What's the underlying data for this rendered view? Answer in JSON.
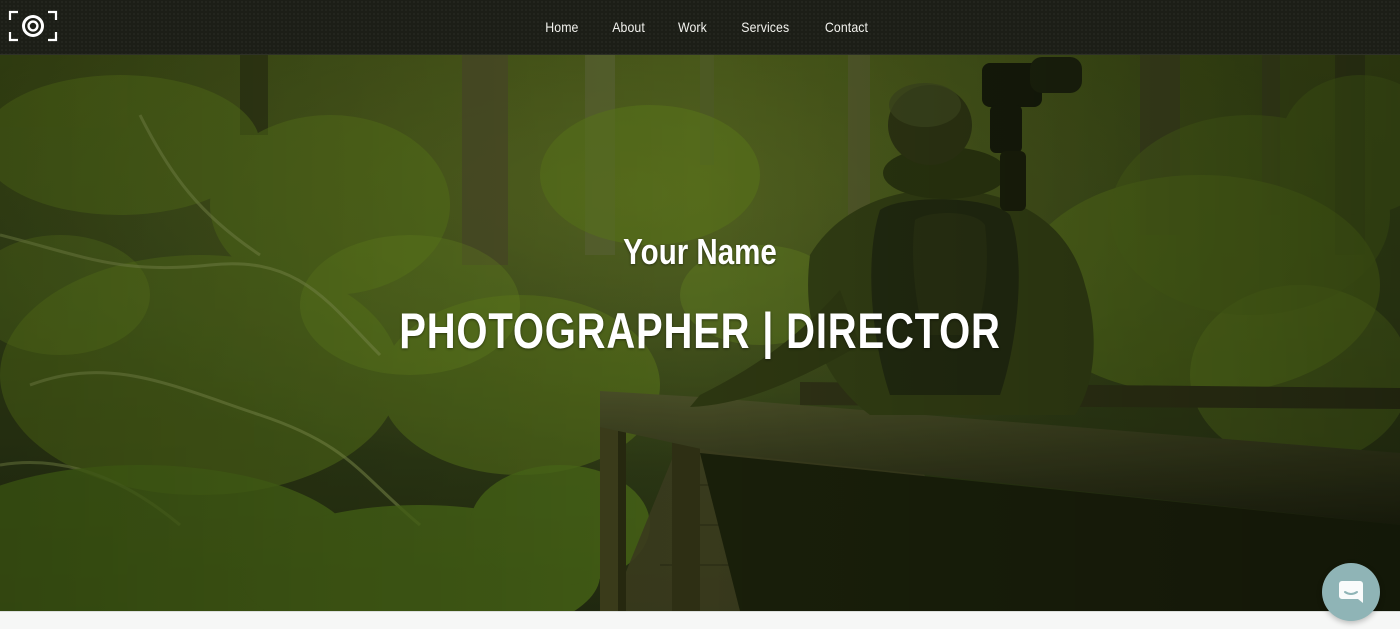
{
  "nav": {
    "logo_icon": "camera-lens-viewfinder-icon",
    "links": [
      {
        "label": "Home"
      },
      {
        "label": "About"
      },
      {
        "label": "Work"
      },
      {
        "label": "Services"
      },
      {
        "label": "Contact"
      }
    ]
  },
  "hero": {
    "name": "Your Name",
    "title": "PHOTOGRAPHER | DIRECTOR",
    "background_image": "photographer-with-camera-on-forest-bridge",
    "overlay_color": "#3f5214"
  },
  "chat_widget": {
    "icon": "chat-bubble-smile-icon",
    "color": "#8fb4b6"
  },
  "colors": {
    "nav_background": "#1c1e17",
    "text": "#ffffff"
  }
}
